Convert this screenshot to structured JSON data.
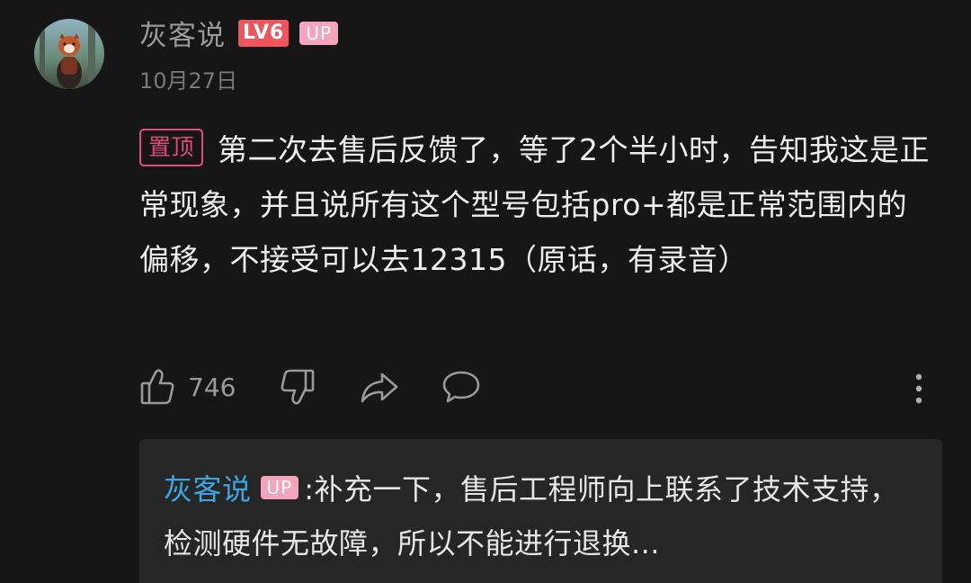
{
  "comment": {
    "username": "灰客说",
    "level_badge": "LV6",
    "up_badge": "UP",
    "date": "10月27日",
    "pin_badge": "置顶",
    "text": "第二次去售后反馈了，等了2个半小时，告知我这是正常现象，并且说所有这个型号包括pro+都是正常范围内的偏移，不接受可以去12315（原话，有录音）",
    "likes": "746"
  },
  "actions": {
    "icons": [
      "like-icon",
      "dislike-icon",
      "share-icon",
      "comment-icon",
      "more-icon"
    ]
  },
  "reply": {
    "username": "灰客说",
    "up_badge": "UP",
    "separator": ":",
    "text": "补充一下，售后工程师向上联系了技术支持，检测硬件无故障，所以不能进行退换..."
  },
  "colors": {
    "background": "#161616",
    "level_badge": "#f0555e",
    "up_badge": "#f6a3bd",
    "pin": "#e34b7c",
    "reply_user": "#3aa8e0",
    "reply_bg": "#262626"
  }
}
